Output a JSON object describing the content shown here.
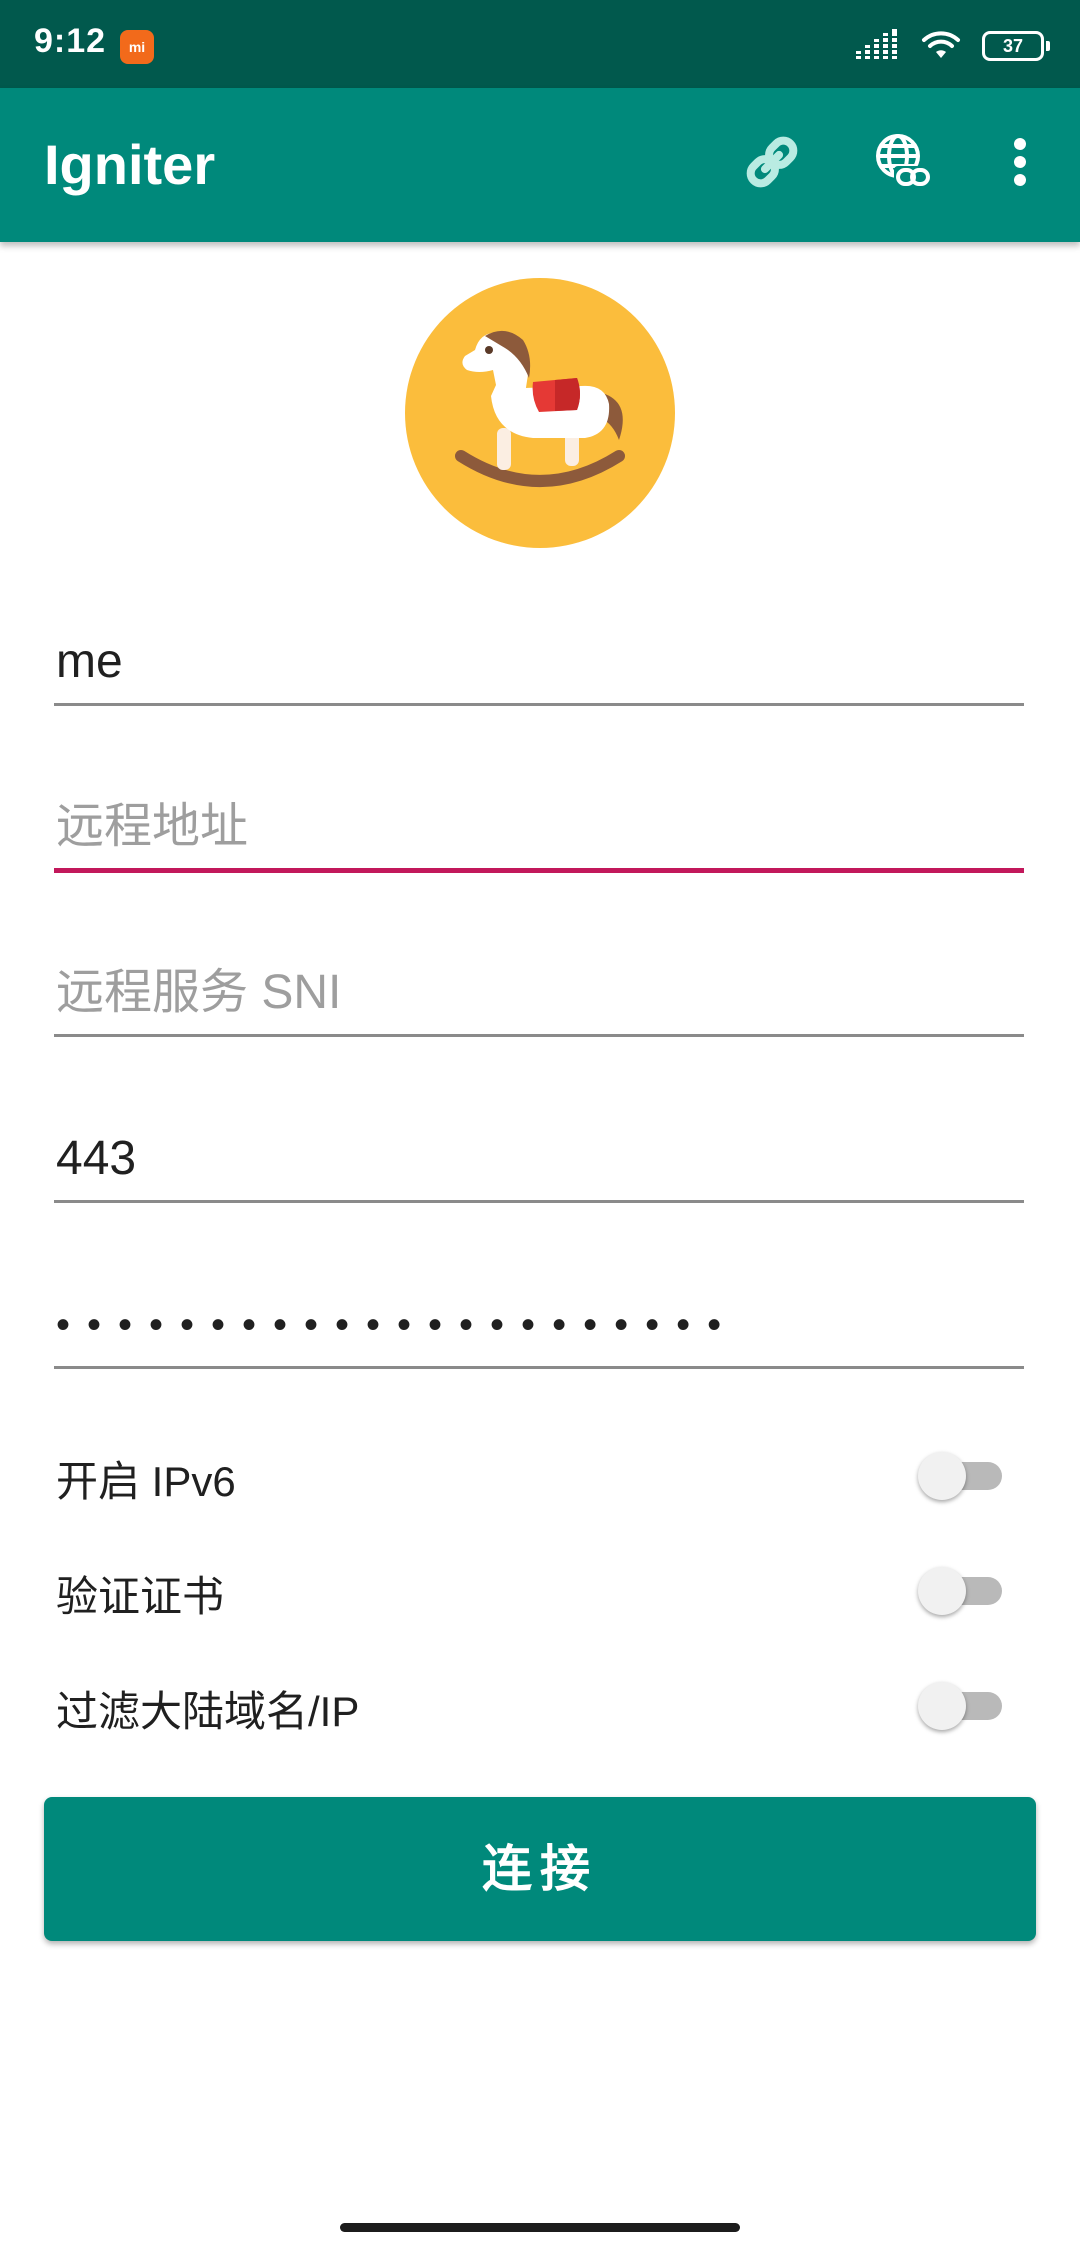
{
  "status_bar": {
    "time": "9:12",
    "badge_text": "mi",
    "battery_level": "37",
    "icons": [
      "signal-icon",
      "wifi-icon",
      "battery-icon"
    ]
  },
  "app_bar": {
    "title": "Igniter",
    "actions": [
      "link-icon",
      "globe-link-icon",
      "overflow-menu-icon"
    ]
  },
  "form": {
    "profile_name": {
      "value": "me",
      "placeholder": ""
    },
    "remote_address": {
      "value": "",
      "placeholder": "远程地址"
    },
    "remote_sni": {
      "value": "",
      "placeholder": "远程服务 SNI"
    },
    "port": {
      "value": "443",
      "placeholder": ""
    },
    "password": {
      "value": "••••••••••••••••••••••",
      "placeholder": ""
    }
  },
  "switches": [
    {
      "label": "开启 IPv6",
      "checked": false
    },
    {
      "label": "验证证书",
      "checked": false
    },
    {
      "label": "过滤大陆域名/IP",
      "checked": false
    }
  ],
  "connect_button": {
    "label": "连接"
  },
  "colors": {
    "primary": "#00897b",
    "primary_dark": "#01594d",
    "accent": "#c2185b",
    "logo_background": "#fbbd3c"
  }
}
